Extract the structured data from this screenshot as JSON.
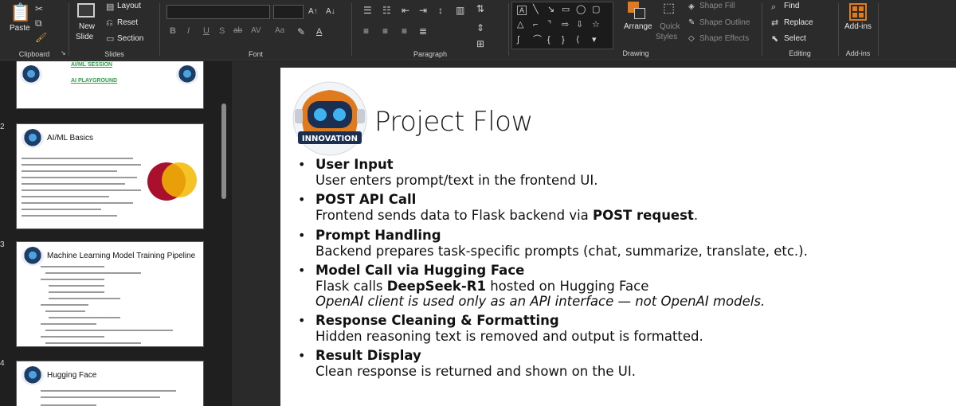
{
  "ribbon": {
    "clipboard": {
      "paste_label": "Paste",
      "group_label": "Clipboard"
    },
    "slides": {
      "new_slide_label": "New",
      "new_slide_label2": "Slide",
      "layout_label": "Layout",
      "reset_label": "Reset",
      "section_label": "Section",
      "group_label": "Slides"
    },
    "font": {
      "bold": "B",
      "italic": "I",
      "underline": "U",
      "shadow": "S",
      "strike": "ab",
      "spacing": "AV",
      "case": "Aa",
      "group_label": "Font"
    },
    "paragraph": {
      "group_label": "Paragraph"
    },
    "drawing": {
      "arrange_label": "Arrange",
      "quick_styles_label": "Quick",
      "quick_styles_label2": "Styles",
      "shape_fill_label": "Shape Fill",
      "shape_outline_label": "Shape Outline",
      "shape_effects_label": "Shape Effects",
      "group_label": "Drawing"
    },
    "editing": {
      "find_label": "Find",
      "replace_label": "Replace",
      "select_label": "Select",
      "group_label": "Editing"
    },
    "addins": {
      "addins_label": "Add-ins",
      "group_label": "Add-ins"
    }
  },
  "thumbnails": [
    {
      "number": "",
      "link1": "AI/ML SESSION",
      "link2": "AI PLAYGROUND"
    },
    {
      "number": "2",
      "title": "AI/ML Basics"
    },
    {
      "number": "3",
      "title": "Machine Learning Model Training Pipeline"
    },
    {
      "number": "4",
      "title": "Hugging Face"
    }
  ],
  "slide": {
    "title": "Project Flow",
    "logo_text": "INNOVATION",
    "items": [
      {
        "heading": "User Input",
        "body": "User enters prompt/text in the frontend UI."
      },
      {
        "heading": "POST API Call",
        "body_pre": "Frontend sends data to Flask backend via ",
        "body_bold": "POST request",
        "body_post": "."
      },
      {
        "heading": "Prompt Handling",
        "body": "Backend prepares task-specific prompts (chat, summarize, translate, etc.)."
      },
      {
        "heading": "Model Call via Hugging Face",
        "body_pre": "Flask calls ",
        "body_bold": "DeepSeek-R1",
        "body_post": " hosted on Hugging Face",
        "italic": "OpenAI client is used only as an API interface — not OpenAI models."
      },
      {
        "heading": "Response Cleaning & Formatting",
        "body": "Hidden reasoning text is removed and output is formatted."
      },
      {
        "heading": "Result Display",
        "body": "Clean response is returned and shown on the UI."
      }
    ]
  },
  "colors": {
    "ribbon_bg": "#2b2b2b",
    "accent_orange": "#e07a1f",
    "link_green": "#2e9d4c"
  }
}
